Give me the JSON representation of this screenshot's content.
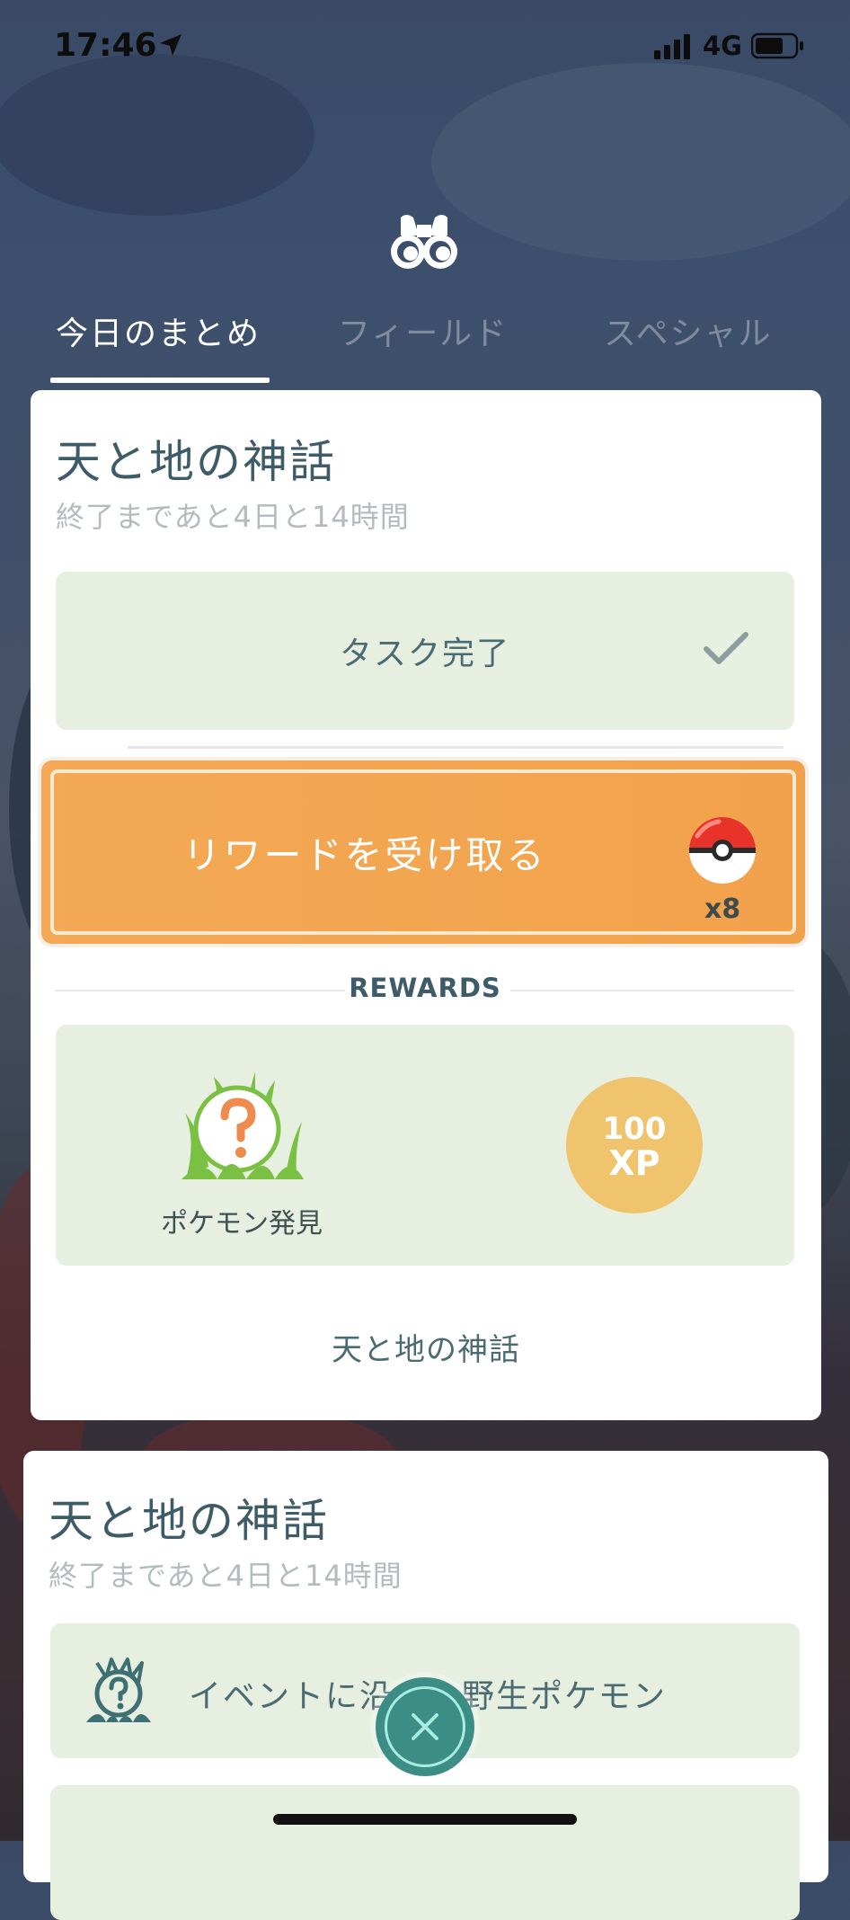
{
  "status_bar": {
    "time": "17:46",
    "network": "4G",
    "location_icon": "location-arrow-icon",
    "signal_icon": "cellular-signal-icon",
    "battery_icon": "battery-icon"
  },
  "header": {
    "icon": "binoculars-icon"
  },
  "tabs": [
    {
      "label": "今日のまとめ",
      "active": true
    },
    {
      "label": "フィールド",
      "active": false
    },
    {
      "label": "スペシャル",
      "active": false
    }
  ],
  "research_card": {
    "title": "天と地の神話",
    "subtitle": "終了まであと4日と14時間",
    "task_status": "タスク完了",
    "claim_button": "リワードを受け取る",
    "reward_item_count": "x8",
    "rewards_heading": "REWARDS",
    "reward_encounter_label": "ポケモン発見",
    "reward_xp_value": "100",
    "reward_xp_unit": "XP",
    "footer": "天と地の神話"
  },
  "research_card_2": {
    "title": "天と地の神話",
    "subtitle": "終了まであと4日と14時間",
    "task_label": "イベントに沿った野生ポケモン"
  },
  "colors": {
    "accent_orange": "#f2a24b",
    "task_bg": "#e6efe0",
    "title_text": "#3e5b68",
    "close_button": "#3c8d86",
    "xp_badge": "#f0c46c"
  }
}
